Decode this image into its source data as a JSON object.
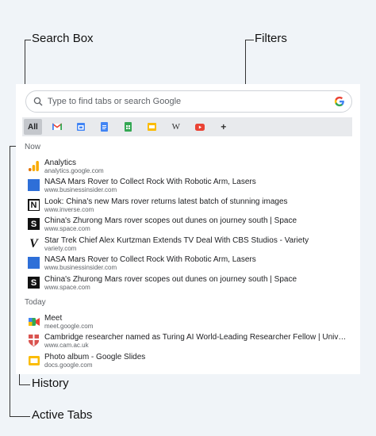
{
  "callouts": {
    "search_box": "Search Box",
    "filters": "Filters",
    "history": "History",
    "active_tabs": "Active Tabs"
  },
  "search": {
    "placeholder": "Type to find tabs or search Google"
  },
  "filters": {
    "all_label": "All",
    "chips": [
      "gmail-icon",
      "calendar-icon",
      "docs-icon",
      "sheets-icon",
      "slides-icon",
      "wikipedia-icon",
      "youtube-icon",
      "add-icon"
    ],
    "wikipedia_glyph": "W",
    "add_glyph": "+"
  },
  "sections": {
    "now": "Now",
    "today": "Today"
  },
  "now_tabs": [
    {
      "title": "Analytics",
      "url": "analytics.google.com",
      "icon": "analytics-icon"
    },
    {
      "title": "NASA Mars Rover to Collect Rock With Robotic Arm, Lasers",
      "url": "www.businessinsider.com",
      "icon": "business-insider-icon"
    },
    {
      "title": "Look: China's new Mars rover returns latest batch of stunning images",
      "url": "www.inverse.com",
      "icon": "inverse-icon"
    },
    {
      "title": "China's Zhurong Mars rover scopes out dunes on journey south | Space",
      "url": "www.space.com",
      "icon": "space-icon"
    },
    {
      "title": "Star Trek Chief Alex Kurtzman Extends TV Deal With CBS Studios - Variety",
      "url": "variety.com",
      "icon": "variety-icon"
    },
    {
      "title": "NASA Mars Rover to Collect Rock With Robotic Arm, Lasers",
      "url": "www.businessinsider.com",
      "icon": "business-insider-icon"
    },
    {
      "title": "China's Zhurong Mars rover scopes out dunes on journey south | Space",
      "url": "www.space.com",
      "icon": "space-icon"
    }
  ],
  "today_tabs": [
    {
      "title": "Meet",
      "url": "meet.google.com",
      "icon": "meet-icon"
    },
    {
      "title": "Cambridge researcher named as Turing AI World-Leading Researcher Fellow | Universi...",
      "url": "www.cam.ac.uk",
      "icon": "cambridge-icon"
    },
    {
      "title": "Photo album - Google Slides",
      "url": "docs.google.com",
      "icon": "slides-icon"
    }
  ],
  "favicon_letters": {
    "inverse": "N",
    "space": "S",
    "variety": "V"
  },
  "colors": {
    "business_insider": "#2e6fd8",
    "google_blue": "#4285f4",
    "google_red": "#ea4335",
    "google_yellow": "#fbbc04",
    "google_green": "#34a853",
    "analytics_orange": "#f9ab00",
    "cambridge_red": "#d9534f"
  }
}
